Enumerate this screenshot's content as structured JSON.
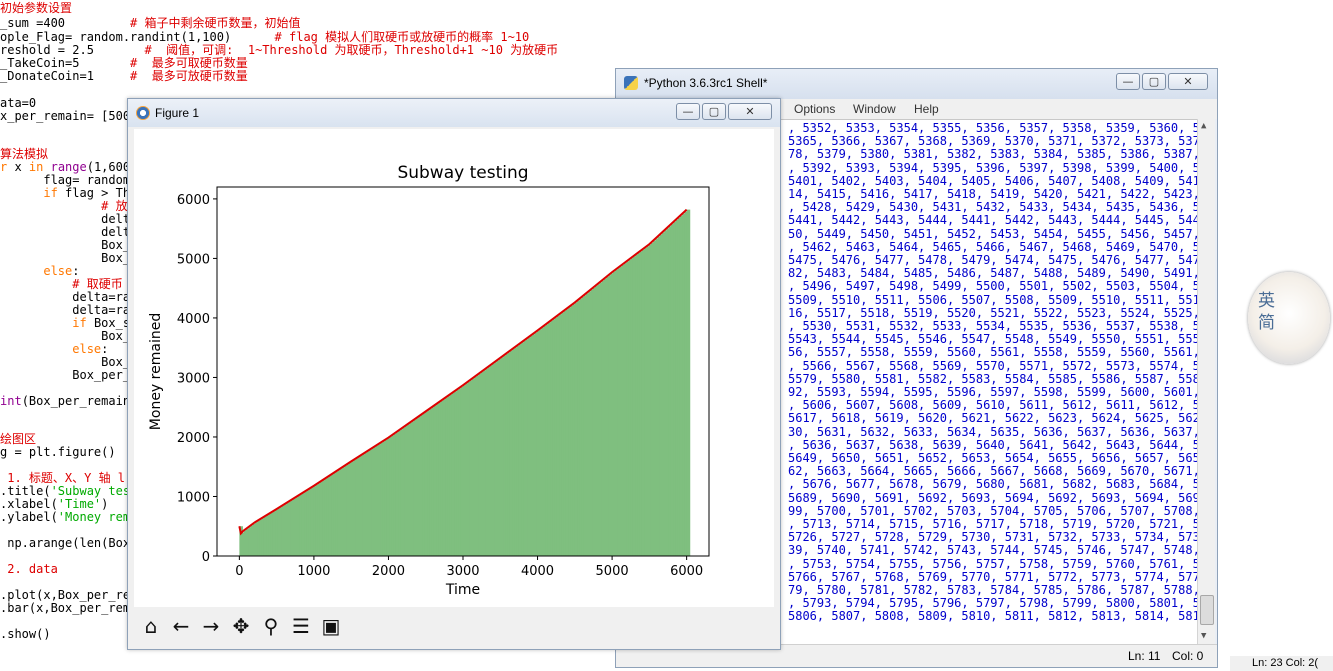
{
  "editor": {
    "lines": [
      {
        "top": 2,
        "parts": [
          {
            "t": "初始参数设置",
            "c": "c-red"
          }
        ]
      },
      {
        "top": 17,
        "parts": [
          {
            "t": "_sum =400         ",
            "c": "c-black"
          },
          {
            "t": "# 箱子中剩余硬币数量，初始值",
            "c": "c-red"
          }
        ]
      },
      {
        "top": 31,
        "parts": [
          {
            "t": "ople_Flag= random.randint(1,100)      ",
            "c": "c-black"
          },
          {
            "t": "# flag 模拟人们取硬币或放硬币的概率 1~10",
            "c": "c-red"
          }
        ]
      },
      {
        "top": 44,
        "parts": [
          {
            "t": "reshold = 2.5       ",
            "c": "c-black"
          },
          {
            "t": "#  阈值，可调:  1~Threshold 为取硬币，Threshold+1 ~10 为放硬币",
            "c": "c-red"
          }
        ]
      },
      {
        "top": 57,
        "parts": [
          {
            "t": "_TakeCoin=5       ",
            "c": "c-black"
          },
          {
            "t": "#  最多可取硬币数量",
            "c": "c-red"
          }
        ]
      },
      {
        "top": 70,
        "parts": [
          {
            "t": "_DonateCoin=1     ",
            "c": "c-black"
          },
          {
            "t": "#  最多可放硬币数量",
            "c": "c-red"
          }
        ]
      },
      {
        "top": 97,
        "parts": [
          {
            "t": "ata=0",
            "c": "c-black"
          }
        ]
      },
      {
        "top": 110,
        "parts": [
          {
            "t": "x_per_remain= [500]",
            "c": "c-black"
          }
        ]
      },
      {
        "top": 148,
        "parts": [
          {
            "t": "算法模拟",
            "c": "c-red"
          }
        ]
      },
      {
        "top": 161,
        "parts": [
          {
            "t": "r ",
            "c": "c-orange"
          },
          {
            "t": "x ",
            "c": "c-black"
          },
          {
            "t": "in ",
            "c": "c-orange"
          },
          {
            "t": "range",
            "c": "c-purple"
          },
          {
            "t": "(1,6000",
            "c": "c-black"
          }
        ]
      },
      {
        "top": 174,
        "parts": [
          {
            "t": "      flag= random.",
            "c": "c-black"
          }
        ]
      },
      {
        "top": 187,
        "parts": [
          {
            "t": "      ",
            "c": "c-black"
          },
          {
            "t": "if ",
            "c": "c-orange"
          },
          {
            "t": "flag > Thr",
            "c": "c-black"
          }
        ]
      },
      {
        "top": 200,
        "parts": [
          {
            "t": "              # 放硬",
            "c": "c-red"
          }
        ]
      },
      {
        "top": 213,
        "parts": [
          {
            "t": "              delta",
            "c": "c-black"
          }
        ]
      },
      {
        "top": 226,
        "parts": [
          {
            "t": "              delta",
            "c": "c-black"
          }
        ]
      },
      {
        "top": 239,
        "parts": [
          {
            "t": "              Box_s",
            "c": "c-black"
          }
        ]
      },
      {
        "top": 252,
        "parts": [
          {
            "t": "              Box_p",
            "c": "c-black"
          }
        ]
      },
      {
        "top": 265,
        "parts": [
          {
            "t": "      ",
            "c": "c-black"
          },
          {
            "t": "else",
            "c": "c-orange"
          },
          {
            "t": ":",
            "c": "c-black"
          }
        ]
      },
      {
        "top": 278,
        "parts": [
          {
            "t": "          # 取硬币",
            "c": "c-red"
          }
        ]
      },
      {
        "top": 291,
        "parts": [
          {
            "t": "          delta=ran",
            "c": "c-black"
          }
        ]
      },
      {
        "top": 304,
        "parts": [
          {
            "t": "          delta=ran",
            "c": "c-black"
          }
        ]
      },
      {
        "top": 317,
        "parts": [
          {
            "t": "          ",
            "c": "c-black"
          },
          {
            "t": "if ",
            "c": "c-orange"
          },
          {
            "t": "Box_su",
            "c": "c-black"
          }
        ]
      },
      {
        "top": 330,
        "parts": [
          {
            "t": "              Box_s",
            "c": "c-black"
          }
        ]
      },
      {
        "top": 343,
        "parts": [
          {
            "t": "          ",
            "c": "c-black"
          },
          {
            "t": "else",
            "c": "c-orange"
          },
          {
            "t": ":",
            "c": "c-black"
          }
        ]
      },
      {
        "top": 356,
        "parts": [
          {
            "t": "              Box_s",
            "c": "c-black"
          }
        ]
      },
      {
        "top": 369,
        "parts": [
          {
            "t": "          Box_per_r",
            "c": "c-black"
          }
        ]
      },
      {
        "top": 395,
        "parts": [
          {
            "t": "int",
            "c": "c-purple"
          },
          {
            "t": "(Box_per_remain)",
            "c": "c-black"
          }
        ]
      },
      {
        "top": 433,
        "parts": [
          {
            "t": "绘图区",
            "c": "c-red"
          }
        ]
      },
      {
        "top": 446,
        "parts": [
          {
            "t": "g = plt.figure()",
            "c": "c-black"
          }
        ]
      },
      {
        "top": 472,
        "parts": [
          {
            "t": " 1. 标题、X、Y 轴 l",
            "c": "c-red"
          }
        ]
      },
      {
        "top": 485,
        "parts": [
          {
            "t": ".title(",
            "c": "c-black"
          },
          {
            "t": "'Subway tes",
            "c": "c-green"
          }
        ]
      },
      {
        "top": 498,
        "parts": [
          {
            "t": ".xlabel(",
            "c": "c-black"
          },
          {
            "t": "'Time'",
            "c": "c-green"
          },
          {
            "t": ")",
            "c": "c-black"
          }
        ]
      },
      {
        "top": 511,
        "parts": [
          {
            "t": ".ylabel(",
            "c": "c-black"
          },
          {
            "t": "'Money rem",
            "c": "c-green"
          }
        ]
      },
      {
        "top": 537,
        "parts": [
          {
            "t": " np.arange(len(Box_",
            "c": "c-black"
          }
        ]
      },
      {
        "top": 563,
        "parts": [
          {
            "t": " 2. data",
            "c": "c-red"
          }
        ]
      },
      {
        "top": 589,
        "parts": [
          {
            "t": ".plot(x,Box_per_re",
            "c": "c-black"
          }
        ]
      },
      {
        "top": 602,
        "parts": [
          {
            "t": ".bar(x,Box_per_rem",
            "c": "c-black"
          }
        ]
      },
      {
        "top": 628,
        "parts": [
          {
            "t": ".show()",
            "c": "c-black"
          }
        ]
      }
    ],
    "status": "Ln: 23   Col: 2("
  },
  "shell": {
    "title": "*Python 3.6.3rc1 Shell*",
    "menu": [
      "Options",
      "Window",
      "Help"
    ],
    "status_ln": "Ln: 11",
    "status_col": "Col: 0",
    "output_lines": [
      ", 5352, 5353, 5354, 5355, 5356, 5357, 5358, 5359, 5360, 53",
      "5365, 5366, 5367, 5368, 5369, 5370, 5371, 5372, 5373, 5374",
      "78, 5379, 5380, 5381, 5382, 5383, 5384, 5385, 5386, 5387,",
      ", 5392, 5393, 5394, 5395, 5396, 5397, 5398, 5399, 5400, 54",
      "5401, 5402, 5403, 5404, 5405, 5406, 5407, 5408, 5409, 5410",
      "14, 5415, 5416, 5417, 5418, 5419, 5420, 5421, 5422, 5423,",
      ", 5428, 5429, 5430, 5431, 5432, 5433, 5434, 5435, 5436, 54",
      "5441, 5442, 5443, 5444, 5441, 5442, 5443, 5444, 5445, 5446",
      "50, 5449, 5450, 5451, 5452, 5453, 5454, 5455, 5456, 5457,",
      ", 5462, 5463, 5464, 5465, 5466, 5467, 5468, 5469, 5470, 54",
      "5475, 5476, 5477, 5478, 5479, 5474, 5475, 5476, 5477, 5478",
      "82, 5483, 5484, 5485, 5486, 5487, 5488, 5489, 5490, 5491,",
      ", 5496, 5497, 5498, 5499, 5500, 5501, 5502, 5503, 5504, 55",
      "5509, 5510, 5511, 5506, 5507, 5508, 5509, 5510, 5511, 5512",
      "16, 5517, 5518, 5519, 5520, 5521, 5522, 5523, 5524, 5525,",
      ", 5530, 5531, 5532, 5533, 5534, 5535, 5536, 5537, 5538, 55",
      "5543, 5544, 5545, 5546, 5547, 5548, 5549, 5550, 5551, 5552",
      "56, 5557, 5558, 5559, 5560, 5561, 5558, 5559, 5560, 5561,",
      ", 5566, 5567, 5568, 5569, 5570, 5571, 5572, 5573, 5574, 55",
      "5579, 5580, 5581, 5582, 5583, 5584, 5585, 5586, 5587, 5588",
      "92, 5593, 5594, 5595, 5596, 5597, 5598, 5599, 5600, 5601,",
      ", 5606, 5607, 5608, 5609, 5610, 5611, 5612, 5611, 5612, 56",
      "5617, 5618, 5619, 5620, 5621, 5622, 5623, 5624, 5625, 5626",
      "30, 5631, 5632, 5633, 5634, 5635, 5636, 5637, 5636, 5637,",
      ", 5636, 5637, 5638, 5639, 5640, 5641, 5642, 5643, 5644, 56",
      "5649, 5650, 5651, 5652, 5653, 5654, 5655, 5656, 5657, 5658",
      "62, 5663, 5664, 5665, 5666, 5667, 5668, 5669, 5670, 5671,",
      ", 5676, 5677, 5678, 5679, 5680, 5681, 5682, 5683, 5684, 56",
      "5689, 5690, 5691, 5692, 5693, 5694, 5692, 5693, 5694, 5695",
      "99, 5700, 5701, 5702, 5703, 5704, 5705, 5706, 5707, 5708,",
      ", 5713, 5714, 5715, 5716, 5717, 5718, 5719, 5720, 5721, 57",
      "5726, 5727, 5728, 5729, 5730, 5731, 5732, 5733, 5734, 5735",
      "39, 5740, 5741, 5742, 5743, 5744, 5745, 5746, 5747, 5748,",
      ", 5753, 5754, 5755, 5756, 5757, 5758, 5759, 5760, 5761, 57",
      "5766, 5767, 5768, 5769, 5770, 5771, 5772, 5773, 5774, 5775",
      "79, 5780, 5781, 5782, 5783, 5784, 5785, 5786, 5787, 5788,",
      ", 5793, 5794, 5795, 5796, 5797, 5798, 5799, 5800, 5801, 58",
      "5806, 5807, 5808, 5809, 5810, 5811, 5812, 5813, 5814, 5815"
    ]
  },
  "figure": {
    "title": "Figure 1",
    "toolbar": [
      {
        "name": "home-icon",
        "glyph": "⌂"
      },
      {
        "name": "back-arrow-icon",
        "glyph": "←"
      },
      {
        "name": "forward-arrow-icon",
        "glyph": "→"
      },
      {
        "name": "pan-icon",
        "glyph": "✥"
      },
      {
        "name": "zoom-icon",
        "glyph": "⚲"
      },
      {
        "name": "configure-subplots-icon",
        "glyph": "☰"
      },
      {
        "name": "save-icon",
        "glyph": "▣"
      }
    ]
  },
  "avatar": {
    "text": "英\n简"
  },
  "chart_data": {
    "type": "bar",
    "title": "Subway testing",
    "xlabel": "Time",
    "ylabel": "Money remained",
    "xlim": [
      -300,
      6300
    ],
    "ylim": [
      0,
      6200
    ],
    "xticks": [
      0,
      1000,
      2000,
      3000,
      4000,
      5000,
      6000
    ],
    "yticks": [
      0,
      1000,
      2000,
      3000,
      4000,
      5000,
      6000
    ],
    "bar_color": "#7fbf7f",
    "line_color": "#dd0000",
    "series": [
      {
        "kind": "line",
        "x": [
          0,
          20,
          50,
          200,
          500,
          1000,
          1500,
          2000,
          2500,
          3000,
          3500,
          4000,
          4500,
          5000,
          5500,
          6000
        ],
        "values": [
          500,
          380,
          420,
          560,
          790,
          1180,
          1590,
          1990,
          2430,
          2870,
          3330,
          3790,
          4260,
          4770,
          5240,
          5820
        ]
      }
    ]
  }
}
